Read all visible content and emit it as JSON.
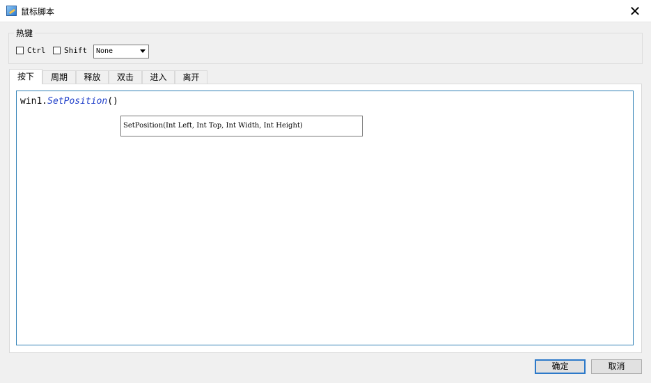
{
  "window": {
    "title": "鼠标脚本",
    "close_symbol": "✕"
  },
  "hotkey": {
    "group_label": "热键",
    "ctrl_label": "Ctrl",
    "ctrl_checked": false,
    "shift_label": "Shift",
    "shift_checked": false,
    "key_value": "None"
  },
  "tabs": [
    {
      "label": "按下",
      "active": true
    },
    {
      "label": "周期",
      "active": false
    },
    {
      "label": "释放",
      "active": false
    },
    {
      "label": "双击",
      "active": false
    },
    {
      "label": "进入",
      "active": false
    },
    {
      "label": "离开",
      "active": false
    }
  ],
  "editor": {
    "object": "win1.",
    "method": "SetPosition",
    "args": "()",
    "tooltip": "SetPosition(Int Left, Int Top, Int Width, Int Height)",
    "method_color": "#1e3ec9",
    "border_color": "#2e7fb5"
  },
  "buttons": {
    "ok": "确定",
    "cancel": "取消"
  },
  "icons": {
    "app": "app-icon",
    "close": "close-icon",
    "dropdown": "chevron-down-icon"
  }
}
